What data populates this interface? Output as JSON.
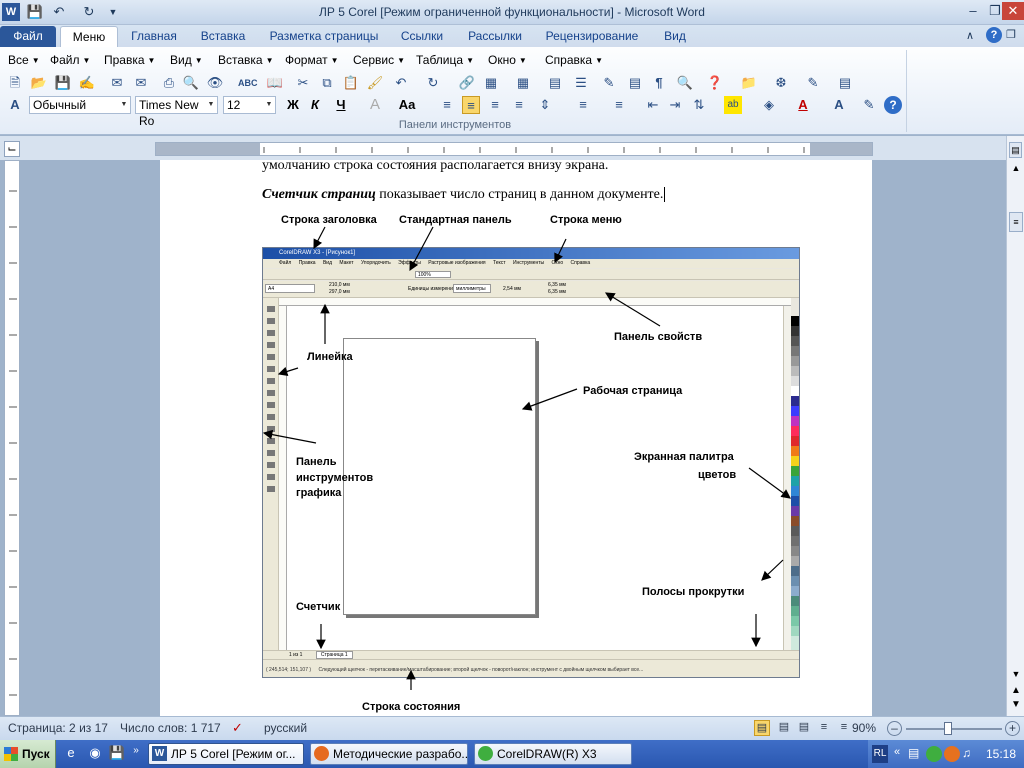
{
  "window": {
    "title": "ЛР 5 Corel [Режим ограниченной функциональности]  -  Microsoft Word"
  },
  "ribbon_tabs": [
    "Файл",
    "Меню",
    "Главная",
    "Вставка",
    "Разметка страницы",
    "Ссылки",
    "Рассылки",
    "Рецензирование",
    "Вид"
  ],
  "menu": [
    "Все",
    "Файл",
    "Правка",
    "Вид",
    "Вставка",
    "Формат",
    "Сервис",
    "Таблица",
    "Окно",
    "Справка"
  ],
  "formatting": {
    "style": "Обычный",
    "font": "Times New Ro",
    "size": "12"
  },
  "ribbon_group": "Панели инструментов",
  "document": {
    "line1": "умолчанию строка состояния располагается  внизу экрана.",
    "line2_em": "Счетчик страниц",
    "line2_rest": " показывает число страниц в данном документе.",
    "labels": {
      "title_bar": "Строка заголовка",
      "std_panel": "Стандартная панель",
      "menu_bar": "Строка меню",
      "props_panel": "Панель свойств",
      "ruler": "Линейка",
      "work_page": "Рабочая страница",
      "palette_1": "Экранная палитра",
      "palette_2": "цветов",
      "tools_1": "Панель",
      "tools_2": "инструментов",
      "tools_3": "графика",
      "counter": "Счетчик",
      "scrollbars": "Полосы прокрутки",
      "status_line": "Строка состояния"
    }
  },
  "corel": {
    "title": "CorelDRAW X3 - [Рисунок1]",
    "menu": [
      "Файл",
      "Правка",
      "Вид",
      "Макет",
      "Упорядочить",
      "Эффекты",
      "Растровые изображения",
      "Текст",
      "Инструменты",
      "Окно",
      "Справка"
    ],
    "zoom": "100%",
    "paper": "A4",
    "width": "210,0 мм",
    "height": "297,0 мм",
    "units_label": "Единицы измерения:",
    "units": "миллиметры",
    "nudge": "2,54 мм",
    "dup1": "6,35 мм",
    "dup2": "6,35 мм",
    "page_counter": "1 из 1",
    "page_tab": "Страница 1",
    "coords": "( 245,514; 151,107 )",
    "status_hint": "Следующий щелчок - перетаскивание/масштабирование; второй щелчок - поворот/наклон; инструмент с двойным щелчком выбирает все..."
  },
  "statusbar": {
    "page": "Страница: 2 из 17",
    "words": "Число слов: 1 717",
    "lang": "русский",
    "zoom": "90%"
  },
  "taskbar": {
    "start": "Пуск",
    "tasks": [
      "ЛР 5 Corel [Режим ог...",
      "Методические разрабо...",
      "CorelDRAW(R) X3"
    ],
    "lang": "RL",
    "time": "15:18"
  },
  "colors": {
    "accent": "#2b579a",
    "ribbon": "#dfe9f5",
    "taskbar": "#2a57b0"
  }
}
